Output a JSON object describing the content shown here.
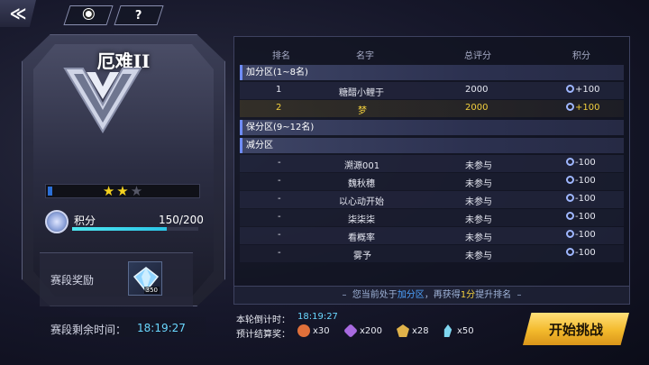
{
  "nav": {
    "back_icon": "back-arrow-icon",
    "record_icon": "record-dot-icon",
    "help_label": "?"
  },
  "rank": {
    "title": "厄难II",
    "stars_total": 3,
    "stars_filled": 2,
    "points_label": "积分",
    "points_value": "150/200",
    "points_progress": 0.75
  },
  "reward": {
    "label": "赛段奖励",
    "item_count": "350"
  },
  "season": {
    "label": "赛段剩余时间：",
    "time": "18:19:27"
  },
  "table": {
    "headers": {
      "rank": "排名",
      "name": "名字",
      "score": "总评分",
      "points": "积分"
    },
    "sections": {
      "promote": "加分区(1~8名)",
      "keep": "保分区(9~12名)",
      "demote": "减分区"
    },
    "promote_rows": [
      {
        "rank": "1",
        "name": "糖醋小鲤于",
        "score": "2000",
        "points": "+100"
      },
      {
        "rank": "2",
        "name": "梦",
        "score": "2000",
        "points": "+100"
      }
    ],
    "demote_rows": [
      {
        "rank": "-",
        "name": "溯源001",
        "score": "未参与",
        "points": "-100"
      },
      {
        "rank": "-",
        "name": "魏秋穗",
        "score": "未参与",
        "points": "-100"
      },
      {
        "rank": "-",
        "name": "以心动开始",
        "score": "未参与",
        "points": "-100"
      },
      {
        "rank": "-",
        "name": "柒柒柒",
        "score": "未参与",
        "points": "-100"
      },
      {
        "rank": "-",
        "name": "看概率",
        "score": "未参与",
        "points": "-100"
      },
      {
        "rank": "-",
        "name": "雾予",
        "score": "未参与",
        "points": "-100"
      }
    ]
  },
  "notice": {
    "prefix": "您当前处于",
    "zone": "加分区",
    "middle": "，再获得",
    "need": "1分",
    "suffix": "提升排名"
  },
  "round": {
    "countdown_label": "本轮倒计时：",
    "countdown": "18:19:27",
    "est_label": "预计结算奖："
  },
  "est_rewards": [
    {
      "icon": "orange-chip-icon",
      "color": "#e0703a",
      "count": "x30"
    },
    {
      "icon": "purple-gem-icon",
      "color": "#a86ae0",
      "count": "x200"
    },
    {
      "icon": "gold-crest-icon",
      "color": "#e0b24a",
      "count": "x28"
    },
    {
      "icon": "crystal-icon",
      "color": "#7fd6f0",
      "count": "x50"
    }
  ],
  "start_button": "开始挑战",
  "colors": {
    "accent": "#6ad8ff",
    "gold": "#f2cf3d",
    "button": "#f3b92c"
  }
}
